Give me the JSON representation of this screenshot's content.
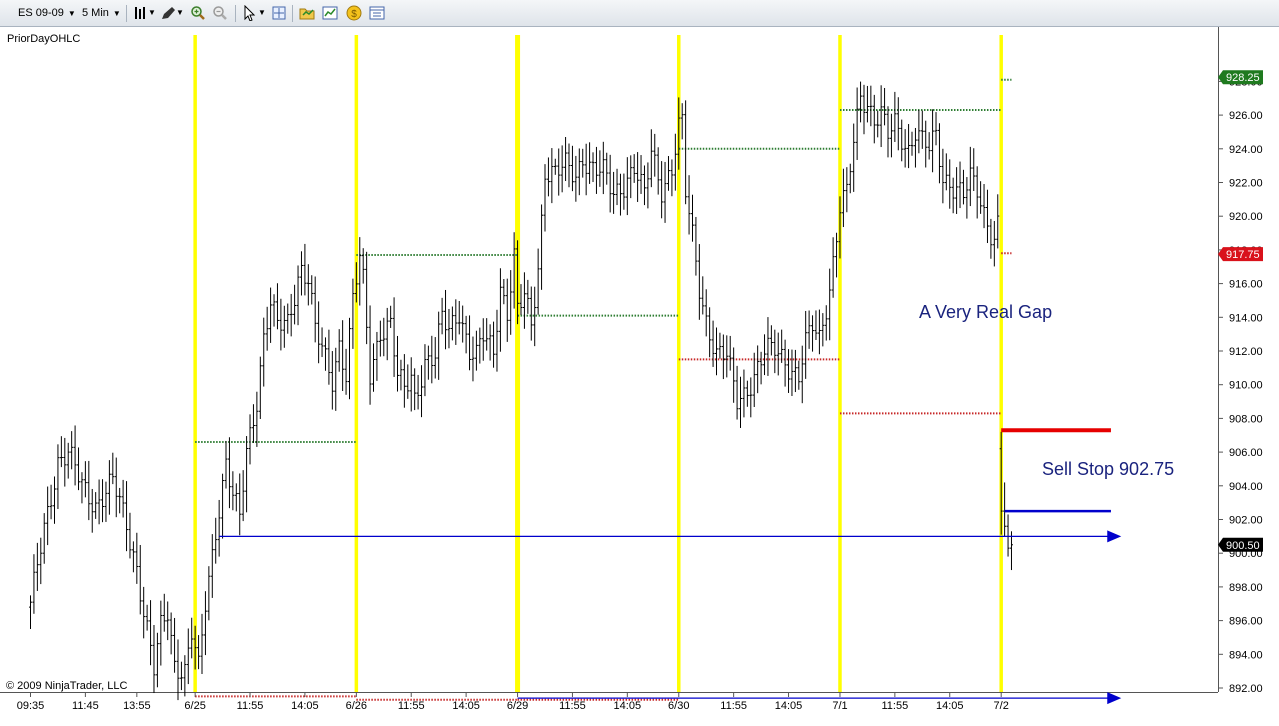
{
  "toolbar": {
    "instrument": "ES 09-09",
    "interval": "5 Min",
    "icons": [
      "bar-style-icon",
      "drawing-pencil-icon",
      "zoom-in-icon",
      "zoom-out-icon",
      "cursor-pointer-icon",
      "crosshair-icon",
      "open-folder-icon",
      "chart-properties-icon",
      "strategy-coin-icon",
      "data-box-icon"
    ]
  },
  "chart_data": {
    "type": "ohlc-bar",
    "indicator_label": "PriorDayOHLC",
    "copyright": "© 2009 NinjaTrader, LLC",
    "ylim": [
      890.5,
      928.9
    ],
    "y_ticks": [
      892,
      894,
      896,
      898,
      900,
      902,
      904,
      906,
      908,
      910,
      912,
      914,
      916,
      918,
      920,
      922,
      924,
      926,
      928
    ],
    "y_tick_labels": [
      "892.00",
      "894.00",
      "896.00",
      "898.00",
      "900.00",
      "902.00",
      "904.00",
      "906.00",
      "908.00",
      "910.00",
      "912.00",
      "914.00",
      "916.00",
      "918.00",
      "920.00",
      "922.00",
      "924.00",
      "926.00",
      "928.00"
    ],
    "x_ticks": [
      {
        "i": 0,
        "label": "09:35"
      },
      {
        "i": 16,
        "label": "11:45"
      },
      {
        "i": 31,
        "label": "13:55"
      },
      {
        "i": 48,
        "label": "6/25"
      },
      {
        "i": 64,
        "label": "11:55"
      },
      {
        "i": 80,
        "label": "14:05"
      },
      {
        "i": 95,
        "label": "6/26"
      },
      {
        "i": 111,
        "label": "11:55"
      },
      {
        "i": 127,
        "label": "14:05"
      },
      {
        "i": 142,
        "label": "6/29"
      },
      {
        "i": 158,
        "label": "11:55"
      },
      {
        "i": 174,
        "label": "14:05"
      },
      {
        "i": 189,
        "label": "6/30"
      },
      {
        "i": 205,
        "label": "11:55"
      },
      {
        "i": 221,
        "label": "14:05"
      },
      {
        "i": 236,
        "label": "7/1"
      },
      {
        "i": 252,
        "label": "11:55"
      },
      {
        "i": 268,
        "label": "14:05"
      },
      {
        "i": 283,
        "label": "7/2"
      }
    ],
    "bar_count": 287,
    "session_starts": [
      48,
      95,
      142,
      189,
      236,
      283
    ],
    "price_path": [
      [
        0,
        896.8
      ],
      [
        4,
        901.5
      ],
      [
        8,
        905.5
      ],
      [
        11,
        905.9
      ],
      [
        15,
        904.0
      ],
      [
        19,
        902.9
      ],
      [
        24,
        904.2
      ],
      [
        28,
        901.7
      ],
      [
        31,
        899.2
      ],
      [
        33,
        896.6
      ],
      [
        36,
        893.0
      ],
      [
        38,
        895.5
      ],
      [
        40,
        896.6
      ],
      [
        42,
        893.5
      ],
      [
        45,
        893.0
      ],
      [
        47,
        895.2
      ],
      [
        49,
        893.0
      ],
      [
        51,
        897.0
      ],
      [
        54,
        901.5
      ],
      [
        57,
        905.4
      ],
      [
        59,
        903.3
      ],
      [
        61,
        902.0
      ],
      [
        63,
        906.0
      ],
      [
        66,
        909.2
      ],
      [
        68,
        912.9
      ],
      [
        70,
        914.8
      ],
      [
        72,
        913.4
      ],
      [
        75,
        913.6
      ],
      [
        78,
        916.4
      ],
      [
        79,
        917.0
      ],
      [
        81,
        916.3
      ],
      [
        83,
        913.2
      ],
      [
        86,
        911.4
      ],
      [
        88,
        910.3
      ],
      [
        90,
        912.5
      ],
      [
        92,
        910.7
      ],
      [
        94,
        915.0
      ],
      [
        96,
        917.4
      ],
      [
        97,
        916.0
      ],
      [
        99,
        910.6
      ],
      [
        102,
        913.3
      ],
      [
        105,
        913.6
      ],
      [
        107,
        910.4
      ],
      [
        109,
        909.6
      ],
      [
        111,
        910.5
      ],
      [
        112,
        909.2
      ],
      [
        115,
        911.4
      ],
      [
        118,
        911.6
      ],
      [
        120,
        913.9
      ],
      [
        122,
        913.2
      ],
      [
        125,
        914.5
      ],
      [
        128,
        912.0
      ],
      [
        130,
        911.6
      ],
      [
        132,
        912.8
      ],
      [
        135,
        912.0
      ],
      [
        137,
        915.9
      ],
      [
        139,
        914.4
      ],
      [
        141,
        917.5
      ],
      [
        142,
        914.3
      ],
      [
        144,
        915.2
      ],
      [
        146,
        913.5
      ],
      [
        148,
        917.0
      ],
      [
        150,
        922.8
      ],
      [
        153,
        922.5
      ],
      [
        156,
        922.9
      ],
      [
        159,
        922.4
      ],
      [
        161,
        923.6
      ],
      [
        164,
        922.8
      ],
      [
        167,
        922.5
      ],
      [
        170,
        921.3
      ],
      [
        173,
        922.0
      ],
      [
        176,
        922.9
      ],
      [
        179,
        921.1
      ],
      [
        181,
        923.8
      ],
      [
        184,
        921.7
      ],
      [
        187,
        922.9
      ],
      [
        189,
        925.2
      ],
      [
        190,
        925.4
      ],
      [
        191,
        921.3
      ],
      [
        193,
        918.8
      ],
      [
        195,
        915.9
      ],
      [
        197,
        913.9
      ],
      [
        200,
        911.7
      ],
      [
        203,
        911.6
      ],
      [
        206,
        909.2
      ],
      [
        208,
        909.6
      ],
      [
        211,
        910.4
      ],
      [
        214,
        911.8
      ],
      [
        217,
        912.2
      ],
      [
        220,
        911.6
      ],
      [
        222,
        910.8
      ],
      [
        224,
        910.4
      ],
      [
        226,
        912.3
      ],
      [
        228,
        913.5
      ],
      [
        230,
        912.8
      ],
      [
        233,
        915.8
      ],
      [
        235,
        918.8
      ],
      [
        236,
        920.5
      ],
      [
        238,
        921.2
      ],
      [
        240,
        924.4
      ],
      [
        242,
        927.2
      ],
      [
        244,
        926.8
      ],
      [
        246,
        925.8
      ],
      [
        248,
        926.0
      ],
      [
        250,
        924.7
      ],
      [
        252,
        925.4
      ],
      [
        254,
        924.7
      ],
      [
        256,
        924.0
      ],
      [
        258,
        925.2
      ],
      [
        260,
        924.4
      ],
      [
        262,
        923.9
      ],
      [
        264,
        924.7
      ],
      [
        266,
        922.3
      ],
      [
        268,
        922.1
      ],
      [
        270,
        921.7
      ],
      [
        272,
        921.2
      ],
      [
        274,
        922.1
      ],
      [
        276,
        921.5
      ],
      [
        278,
        920.2
      ],
      [
        280,
        919.2
      ],
      [
        281,
        918.8
      ],
      [
        282,
        919.6
      ]
    ],
    "last_day_bars": [
      {
        "i": 283,
        "o": 906.2,
        "h": 907.2,
        "l": 901.1,
        "c": 902.5
      },
      {
        "i": 284,
        "o": 902.5,
        "h": 904.2,
        "l": 901.0,
        "c": 901.6
      },
      {
        "i": 285,
        "o": 901.6,
        "h": 902.3,
        "l": 899.8,
        "c": 900.3
      },
      {
        "i": 286,
        "o": 900.3,
        "h": 901.3,
        "l": 899.0,
        "c": 900.5
      }
    ],
    "prior_day_levels": [
      {
        "from": 48,
        "to": 95,
        "high": 906.6,
        "low": 891.5
      },
      {
        "from": 95,
        "to": 142,
        "high": 917.7,
        "low": 891.3
      },
      {
        "from": 142,
        "to": 189,
        "high": 914.1,
        "low": 891.3
      },
      {
        "from": 189,
        "to": 236,
        "high": 924.0,
        "low": 911.5
      },
      {
        "from": 236,
        "to": 283,
        "high": 926.3,
        "low": 908.3
      },
      {
        "from": 283,
        "to": 286,
        "high": 928.1,
        "low": 917.8
      }
    ],
    "price_badges": [
      {
        "label": "928.25",
        "value": 928.25,
        "color": "#1f7a1f"
      },
      {
        "label": "917.75",
        "value": 917.75,
        "color": "#d9121b"
      },
      {
        "label": "900.50",
        "value": 900.5,
        "color": "#000000"
      }
    ],
    "annotations": {
      "gap_text": "A Very Real Gap",
      "sell_stop_text": "Sell Stop 902.75",
      "red_line": {
        "from_i": 283,
        "to_i": 315,
        "value": 907.3
      },
      "blue_short_line": {
        "from_i": 284,
        "to_i": 315,
        "value": 902.5
      },
      "arrow_upper": {
        "from_i": 55,
        "to_i": 318,
        "value": 901.0
      },
      "arrow_lower": {
        "from_i": 142,
        "to_i": 318,
        "value": 891.4
      }
    },
    "colors": {
      "session_line": "#ffff00",
      "high_line": "#2e7d32",
      "low_line": "#c62828",
      "arrow": "#0000cc",
      "gap_text": "#1a237e",
      "sell_text": "#1a237e",
      "red_line": "#e60000",
      "blue_line": "#0000cc"
    },
    "grid": false,
    "legend": "none"
  }
}
